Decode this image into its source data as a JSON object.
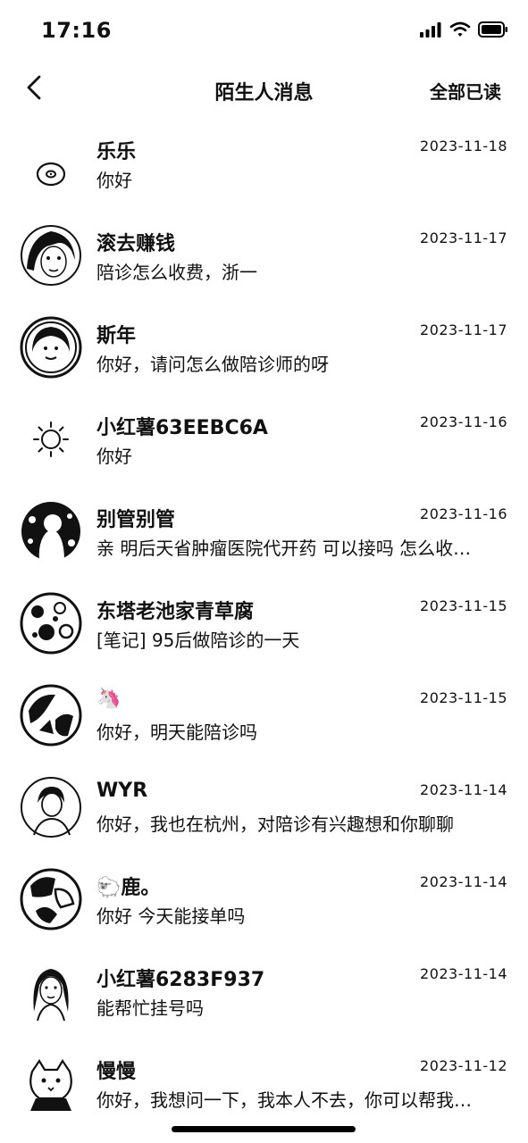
{
  "status_bar": {
    "time": "17:16"
  },
  "header": {
    "title": "陌生人消息",
    "action_label": "全部已读"
  },
  "conversations": [
    {
      "name": "乐乐",
      "date": "2023-11-18",
      "message": "你好"
    },
    {
      "name": "滚去赚钱",
      "date": "2023-11-17",
      "message": "陪诊怎么收费，浙一"
    },
    {
      "name": "斯年",
      "date": "2023-11-17",
      "message": "你好，请问怎么做陪诊师的呀"
    },
    {
      "name": "小红薯63EEBC6A",
      "date": "2023-11-16",
      "message": "你好"
    },
    {
      "name": "别管别管",
      "date": "2023-11-16",
      "message": "亲 明后天省肿瘤医院代开药 可以接吗 怎么收…"
    },
    {
      "name": "东塔老池家青草腐",
      "date": "2023-11-15",
      "message": "[笔记] 95后做陪诊的一天"
    },
    {
      "name": "🦄",
      "date": "2023-11-15",
      "message": "你好，明天能陪诊吗"
    },
    {
      "name": "WYR",
      "date": "2023-11-14",
      "message": "你好，我也在杭州，对陪诊有兴趣想和你聊聊"
    },
    {
      "name": "🐑鹿。",
      "date": "2023-11-14",
      "message": "你好 今天能接单吗"
    },
    {
      "name": "小红薯6283F937",
      "date": "2023-11-14",
      "message": "能帮忙挂号吗"
    },
    {
      "name": "慢慢",
      "date": "2023-11-12",
      "message": "你好，我想问一下，我本人不去，你可以帮我…"
    }
  ],
  "colors": {
    "text": "#111111",
    "background": "#ffffff"
  }
}
